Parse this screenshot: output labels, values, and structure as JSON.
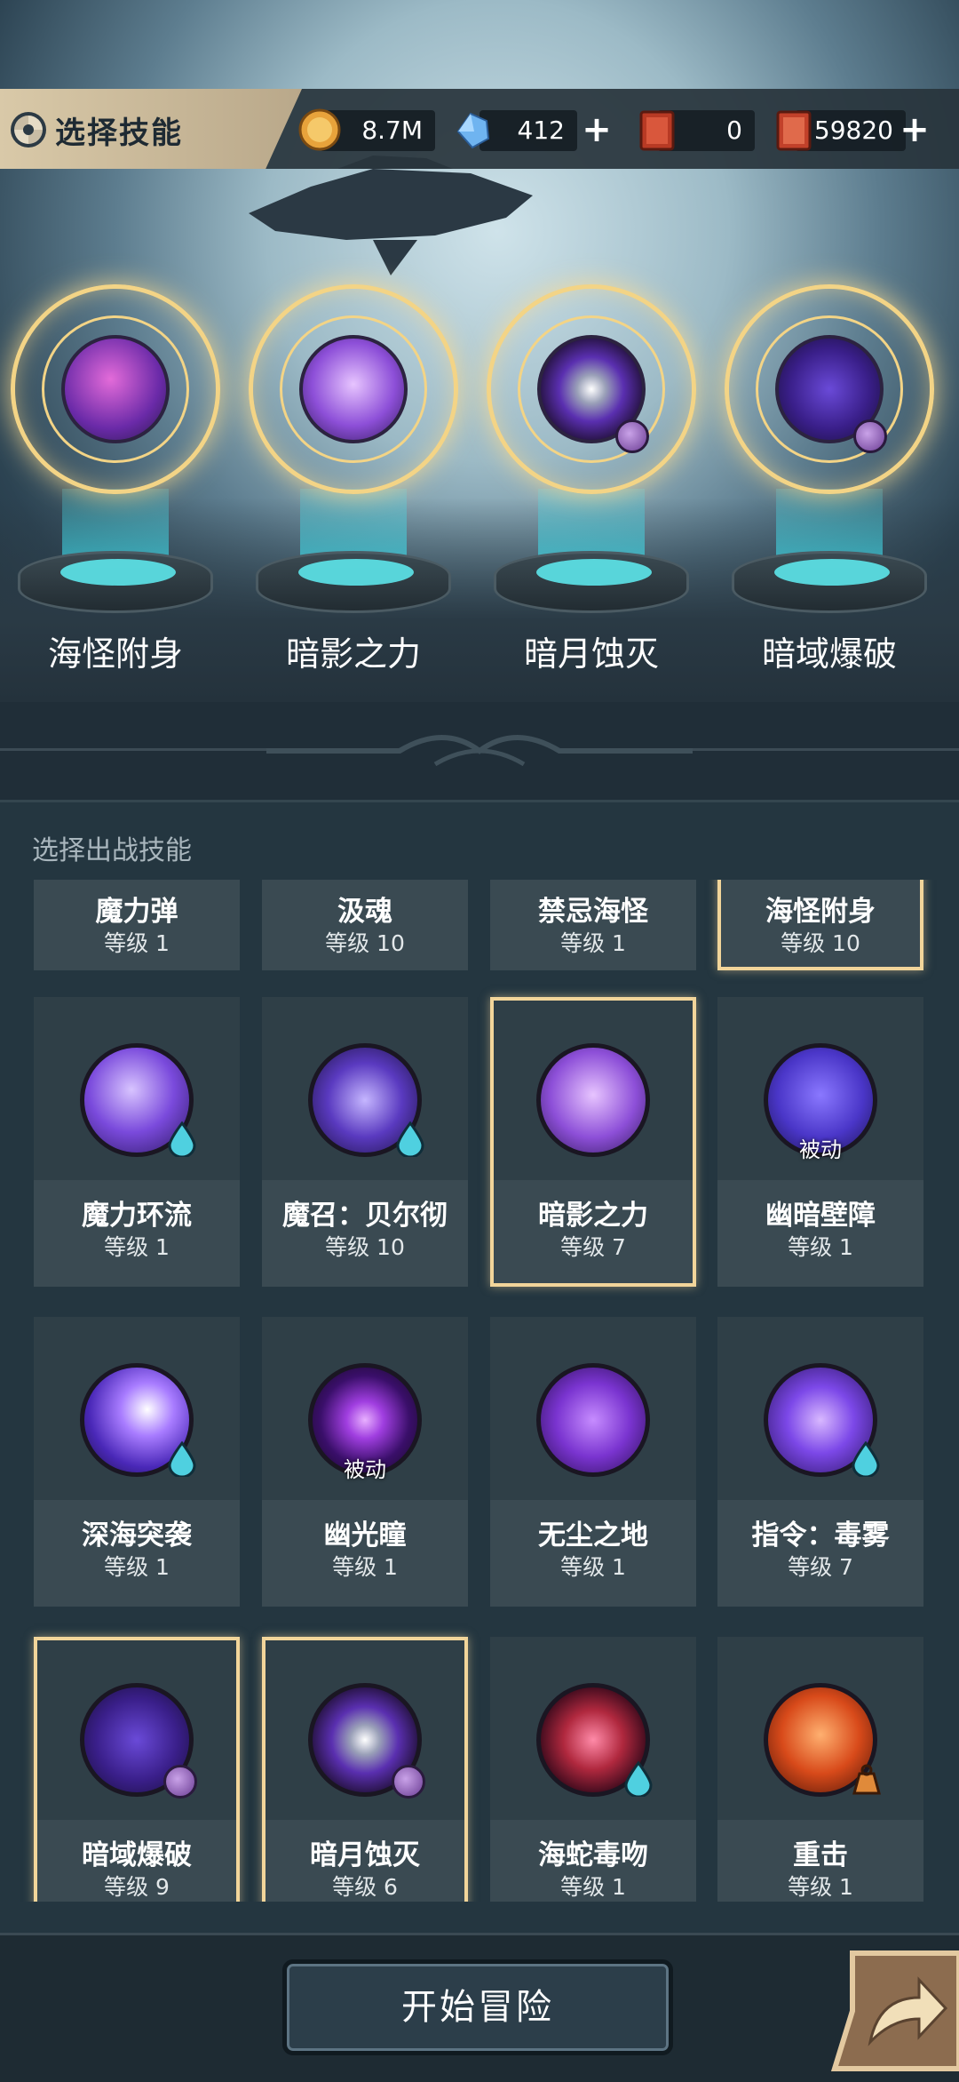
{
  "header": {
    "title": "选择技能"
  },
  "resources": [
    {
      "name": "coin",
      "value": "8.7M"
    },
    {
      "name": "crystal",
      "value": "412"
    },
    {
      "name": "ticket-a",
      "value": "0"
    },
    {
      "name": "ticket-b",
      "value": "59820"
    }
  ],
  "equipped": [
    {
      "name": "海怪附身"
    },
    {
      "name": "暗影之力"
    },
    {
      "name": "暗月蚀灭"
    },
    {
      "name": "暗域爆破"
    }
  ],
  "panel": {
    "title": "选择出战技能"
  },
  "skills_top_row": [
    {
      "name": "魔力弹",
      "level": "等级 1",
      "selected": false
    },
    {
      "name": "汲魂",
      "level": "等级 10",
      "selected": false
    },
    {
      "name": "禁忌海怪",
      "level": "等级 1",
      "selected": false
    },
    {
      "name": "海怪附身",
      "level": "等级 10",
      "selected": true
    }
  ],
  "skills": [
    {
      "name": "魔力环流",
      "level": "等级 1",
      "selected": false,
      "badge": "drop",
      "passive": ""
    },
    {
      "name": "魔召：贝尔彻",
      "level": "等级 10",
      "selected": false,
      "badge": "drop",
      "passive": ""
    },
    {
      "name": "暗影之力",
      "level": "等级 7",
      "selected": true,
      "badge": "",
      "passive": ""
    },
    {
      "name": "幽暗壁障",
      "level": "等级 1",
      "selected": false,
      "badge": "",
      "passive": "被动"
    },
    {
      "name": "深海突袭",
      "level": "等级 1",
      "selected": false,
      "badge": "drop",
      "passive": ""
    },
    {
      "name": "幽光瞳",
      "level": "等级 1",
      "selected": false,
      "badge": "",
      "passive": "被动"
    },
    {
      "name": "无尘之地",
      "level": "等级 1",
      "selected": false,
      "badge": "",
      "passive": ""
    },
    {
      "name": "指令：毒雾",
      "level": "等级 7",
      "selected": false,
      "badge": "drop",
      "passive": ""
    },
    {
      "name": "暗域爆破",
      "level": "等级 9",
      "selected": true,
      "badge": "orb",
      "passive": ""
    },
    {
      "name": "暗月蚀灭",
      "level": "等级 6",
      "selected": true,
      "badge": "orb",
      "passive": ""
    },
    {
      "name": "海蛇毒吻",
      "level": "等级 1",
      "selected": false,
      "badge": "drop",
      "passive": ""
    },
    {
      "name": "重击",
      "level": "等级 1",
      "selected": false,
      "badge": "weight",
      "passive": ""
    }
  ],
  "footer": {
    "start_label": "开始冒险"
  }
}
